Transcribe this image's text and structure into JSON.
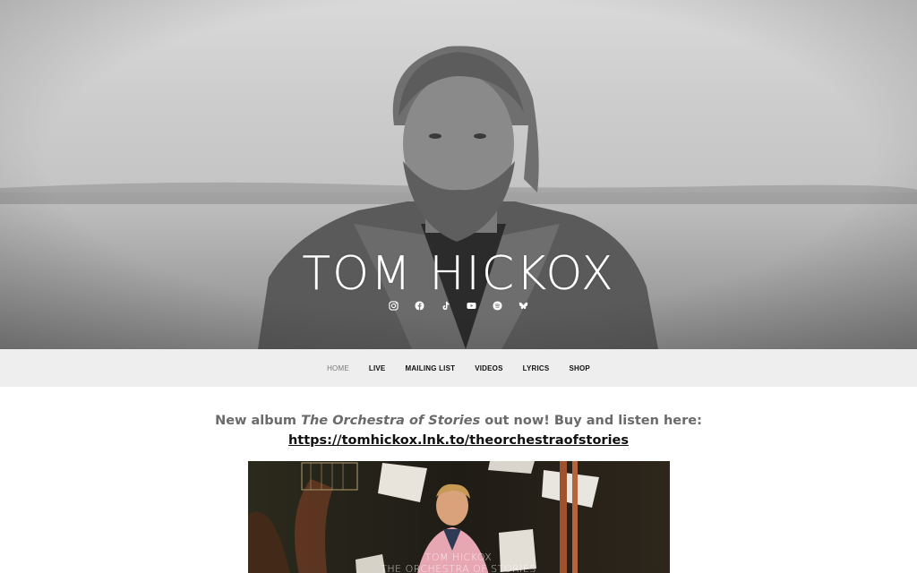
{
  "site": {
    "title": "TOM HICKOX"
  },
  "social": [
    {
      "icon": "instagram-icon"
    },
    {
      "icon": "facebook-icon"
    },
    {
      "icon": "tiktok-icon"
    },
    {
      "icon": "youtube-icon"
    },
    {
      "icon": "spotify-icon"
    },
    {
      "icon": "bluesky-icon"
    }
  ],
  "nav": {
    "items": [
      {
        "label": "HOME"
      },
      {
        "label": "LIVE"
      },
      {
        "label": "MAILING LIST"
      },
      {
        "label": "VIDEOS"
      },
      {
        "label": "LYRICS"
      },
      {
        "label": "SHOP"
      }
    ]
  },
  "main": {
    "announce_prefix": "New album ",
    "album_title": "The Orchestra of Stories",
    "announce_suffix": " out now! Buy and listen here:",
    "link_text": "https://tomhickox.lnk.to/theorchestraofstories",
    "album_art": {
      "artist_line": "TOM HICKOX",
      "title_line": "THE ORCHESTRA OF STORIES"
    }
  },
  "colors": {
    "nav_bg": "#eeeeee",
    "nav_active": "#777777",
    "text_muted": "#6a6a6a",
    "link": "#111111"
  }
}
